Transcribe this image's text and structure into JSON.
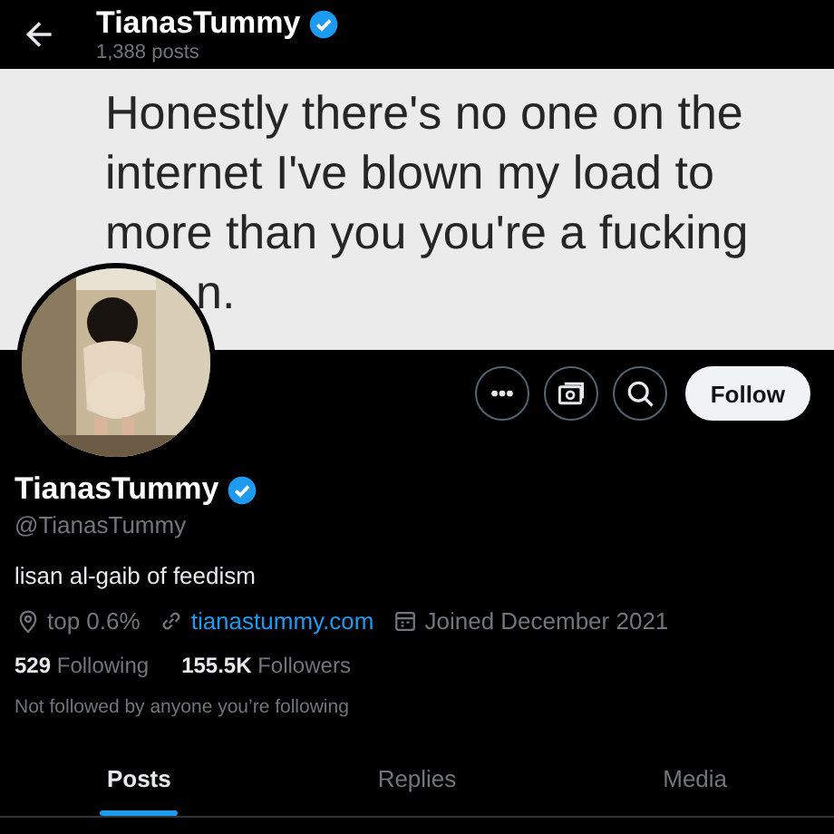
{
  "header": {
    "title": "TianasTummy",
    "verified": true,
    "subtitle": "1,388 posts"
  },
  "banner": {
    "lines": [
      "Honestly there's no one on the",
      "internet I've blown my load to",
      "more than you you're a fucking",
      "n."
    ]
  },
  "actions": [
    {
      "kind": "more"
    },
    {
      "kind": "subscribe"
    },
    {
      "kind": "search"
    },
    {
      "kind": "follow",
      "label": "Follow"
    }
  ],
  "profile": {
    "name": "TianasTummy",
    "verified": true,
    "handle": "@TianasTummy",
    "bio": "lisan al-gaib of feedism",
    "meta": [
      {
        "kind": "location",
        "text": "top 0.6%"
      },
      {
        "kind": "link",
        "text": "tianastummy.com"
      },
      {
        "kind": "joined",
        "text": "Joined December 2021"
      }
    ],
    "stats": [
      {
        "count": "529",
        "label": "Following"
      },
      {
        "count": "155.5K",
        "label": "Followers"
      }
    ],
    "note": "Not followed by anyone you’re following"
  },
  "tabs": [
    {
      "label": "Posts",
      "selected": true
    },
    {
      "label": "Replies",
      "selected": false
    },
    {
      "label": "Media",
      "selected": false
    }
  ]
}
